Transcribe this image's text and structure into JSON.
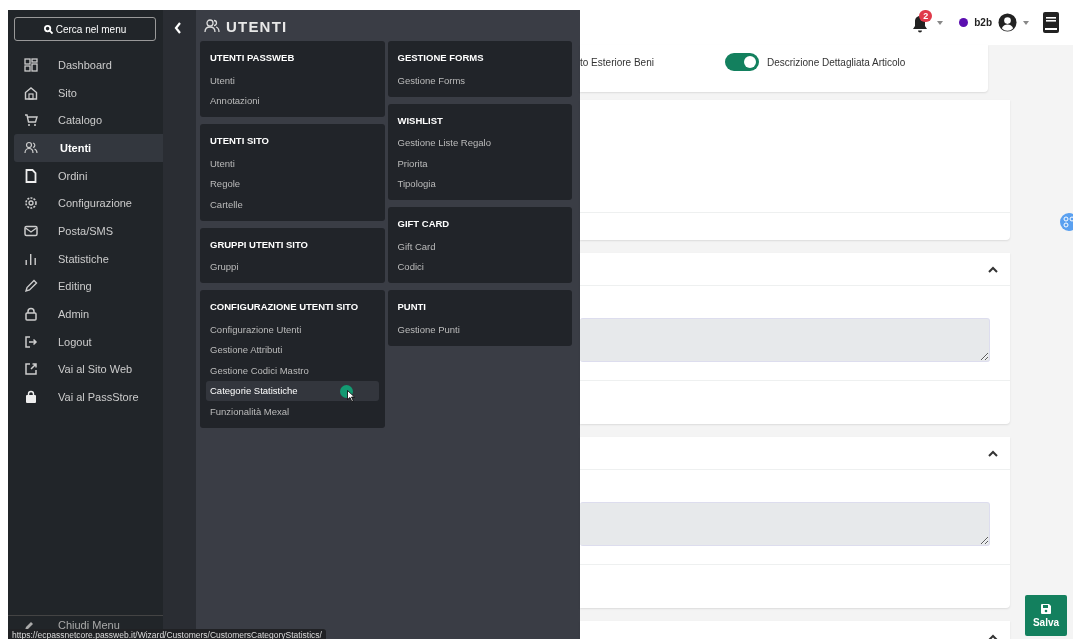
{
  "sidebar": {
    "search_button": "Cerca nel menu",
    "items": [
      {
        "label": "Dashboard",
        "selected": false
      },
      {
        "label": "Sito",
        "selected": false
      },
      {
        "label": "Catalogo",
        "selected": false
      },
      {
        "label": "Utenti",
        "selected": true
      },
      {
        "label": "Ordini",
        "selected": false
      },
      {
        "label": "Configurazione",
        "selected": false
      },
      {
        "label": "Posta/SMS",
        "selected": false
      },
      {
        "label": "Statistiche",
        "selected": false
      },
      {
        "label": "Editing",
        "selected": false
      },
      {
        "label": "Admin",
        "selected": false
      },
      {
        "label": "Logout",
        "selected": false
      },
      {
        "label": "Vai al Sito Web",
        "selected": false
      },
      {
        "label": "Vai al PassStore",
        "selected": false
      }
    ],
    "close_menu": "Chiudi Menu"
  },
  "mega_menu": {
    "title": "UTENTI",
    "columns": [
      [
        {
          "title": "UTENTI PASSWEB",
          "items": [
            {
              "label": "Utenti",
              "selected": false
            },
            {
              "label": "Annotazioni",
              "selected": false
            }
          ]
        },
        {
          "title": "UTENTI SITO",
          "items": [
            {
              "label": "Utenti",
              "selected": false
            },
            {
              "label": "Regole",
              "selected": false
            },
            {
              "label": "Cartelle",
              "selected": false
            }
          ]
        },
        {
          "title": "GRUPPI UTENTI SITO",
          "items": [
            {
              "label": "Gruppi",
              "selected": false
            }
          ]
        },
        {
          "title": "CONFIGURAZIONE UTENTI SITO",
          "items": [
            {
              "label": "Configurazione Utenti",
              "selected": false
            },
            {
              "label": "Gestione Attributi",
              "selected": false
            },
            {
              "label": "Gestione Codici Mastro",
              "selected": false
            },
            {
              "label": "Categorie Statistiche",
              "selected": true
            },
            {
              "label": "Funzionalità Mexal",
              "selected": false
            }
          ]
        }
      ],
      [
        {
          "title": "GESTIONE FORMS",
          "items": [
            {
              "label": "Gestione Forms",
              "selected": false
            }
          ]
        },
        {
          "title": "WISHLIST",
          "items": [
            {
              "label": "Gestione Liste Regalo",
              "selected": false
            },
            {
              "label": "Priorita",
              "selected": false
            },
            {
              "label": "Tipologia",
              "selected": false
            }
          ]
        },
        {
          "title": "GIFT CARD",
          "items": [
            {
              "label": "Gift Card",
              "selected": false
            },
            {
              "label": "Codici",
              "selected": false
            }
          ]
        },
        {
          "title": "PUNTI",
          "items": [
            {
              "label": "Gestione Punti",
              "selected": false
            }
          ]
        }
      ]
    ]
  },
  "header": {
    "notification_count": "2",
    "site": {
      "label": "b2b",
      "color": "#5b0fb0"
    }
  },
  "content": {
    "toggles": [
      {
        "label": "to Esteriore Beni"
      },
      {
        "label": "Descrizione Dettagliata Articolo",
        "on": true
      }
    ],
    "panels": [
      {
        "expanded": true
      },
      {
        "expanded": true
      },
      {
        "expanded": true
      }
    ]
  },
  "save_button": "Salva",
  "status_url": "https://ecpassnetcore.passweb.it/Wizard/Customers/CustomersCategoryStatistics/"
}
